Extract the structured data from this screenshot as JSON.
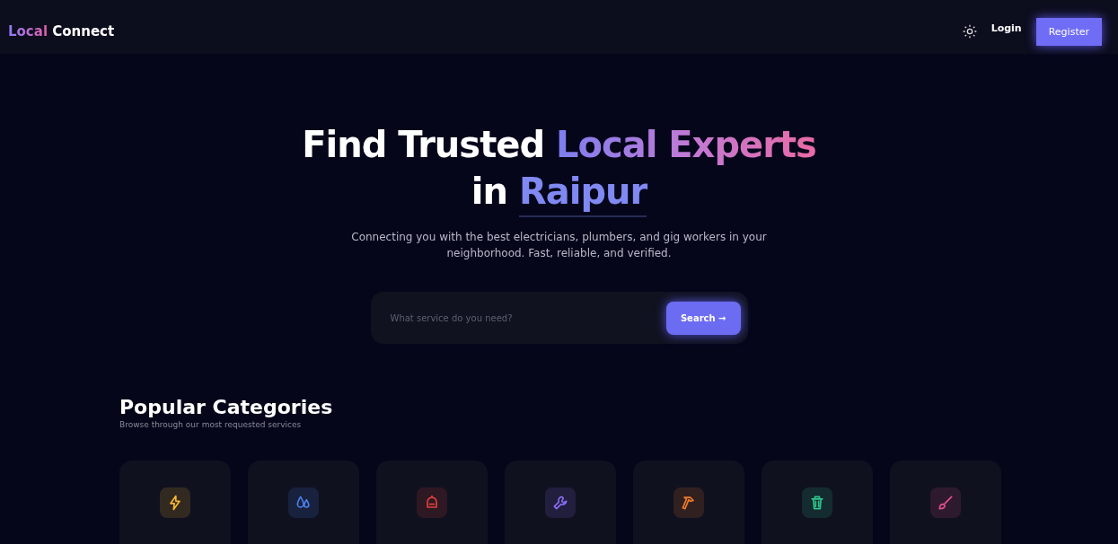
{
  "nav": {
    "logo": {
      "accent": "Local",
      "rest": "Connect"
    },
    "login": "Login",
    "register": "Register"
  },
  "hero": {
    "lines": [
      {
        "plain": "Find Trusted",
        "accent": "Local Experts",
        "kind": "gradient"
      },
      {
        "plain": "in",
        "accent": "Raipur",
        "kind": "underline"
      }
    ],
    "subtitle": "Connecting you with the best electricians, plumbers, and gig workers in your neighborhood. Fast, reliable, and verified.",
    "search": {
      "placeholder": "What service do you need?",
      "button": "Search",
      "arrow": "→"
    }
  },
  "categories": {
    "title": "Popular Categories",
    "subtitle": "Browse through our most requested services",
    "items": [
      {
        "color": "#f5b82e"
      },
      {
        "color": "#4a7fe8"
      },
      {
        "color": "#e0403a"
      },
      {
        "color": "#8a6cf0"
      },
      {
        "color": "#f07a2a"
      },
      {
        "color": "#2ec58a"
      },
      {
        "color": "#e0508f"
      }
    ]
  }
}
